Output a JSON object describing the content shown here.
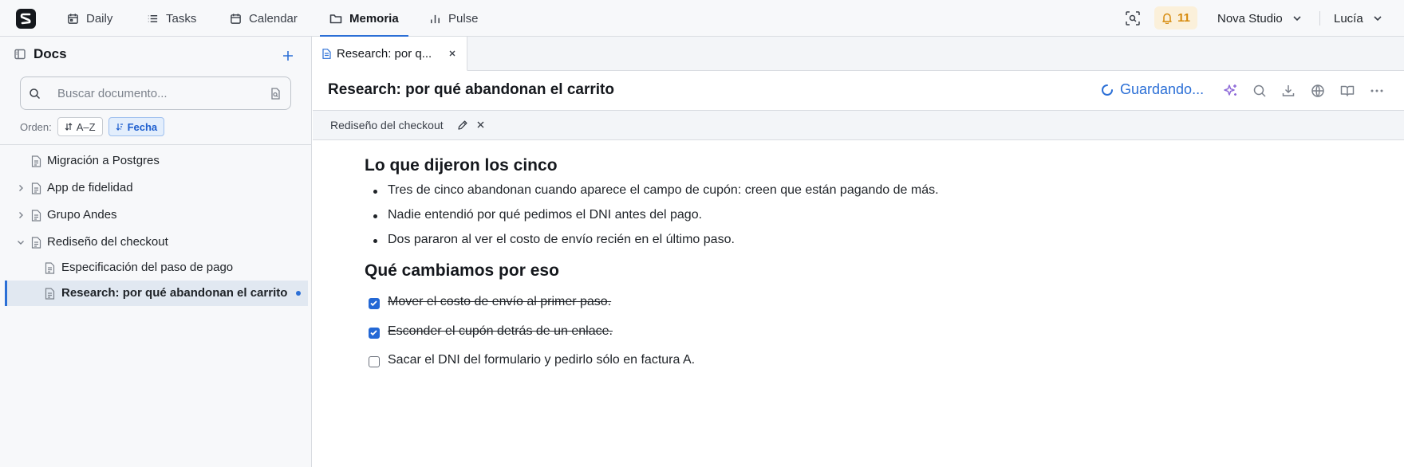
{
  "nav": {
    "tabs": [
      {
        "label": "Daily",
        "icon": "calendar-day-icon"
      },
      {
        "label": "Tasks",
        "icon": "list-icon"
      },
      {
        "label": "Calendar",
        "icon": "calendar-icon"
      },
      {
        "label": "Memoria",
        "icon": "folder-icon",
        "active": true
      },
      {
        "label": "Pulse",
        "icon": "bar-chart-icon"
      }
    ],
    "notifications_count": "11",
    "workspace": "Nova Studio",
    "user": "Lucía"
  },
  "sidebar": {
    "title": "Docs",
    "search_placeholder": "Buscar documento...",
    "order_label": "Orden:",
    "sort_az": "A–Z",
    "sort_date": "Fecha",
    "items": [
      {
        "label": "Migración a Postgres",
        "level": 0,
        "expandable": false
      },
      {
        "label": "App de fidelidad",
        "level": 0,
        "expandable": true,
        "expanded": false
      },
      {
        "label": "Grupo Andes",
        "level": 0,
        "expandable": true,
        "expanded": false
      },
      {
        "label": "Rediseño del checkout",
        "level": 0,
        "expandable": true,
        "expanded": true
      },
      {
        "label": "Especificación del paso de pago",
        "level": 1
      },
      {
        "label": "Research: por qué abandonan el carrito",
        "level": 1,
        "selected": true
      }
    ]
  },
  "tab": {
    "label": "Research: por q..."
  },
  "doc": {
    "title": "Research: por qué abandonan el carrito",
    "saving_status": "Guardando...",
    "breadcrumb": "Rediseño del checkout",
    "section1_heading": "Lo que dijeron los cinco",
    "bullets": [
      "Tres de cinco abandonan cuando aparece el campo de cupón: creen que están pagando de más.",
      "Nadie entendió por qué pedimos el DNI antes del pago.",
      "Dos pararon al ver el costo de envío recién en el último paso."
    ],
    "section2_heading": "Qué cambiamos por eso",
    "tasks": [
      {
        "text": "Mover el costo de envío al primer paso.",
        "done": true
      },
      {
        "text": "Esconder el cupón detrás de un enlace.",
        "done": true
      },
      {
        "text": "Sacar el DNI del formulario y pedirlo sólo en factura A.",
        "done": false
      }
    ]
  },
  "colors": {
    "accent": "#2b6fd6",
    "notification": "#d68a0c"
  }
}
